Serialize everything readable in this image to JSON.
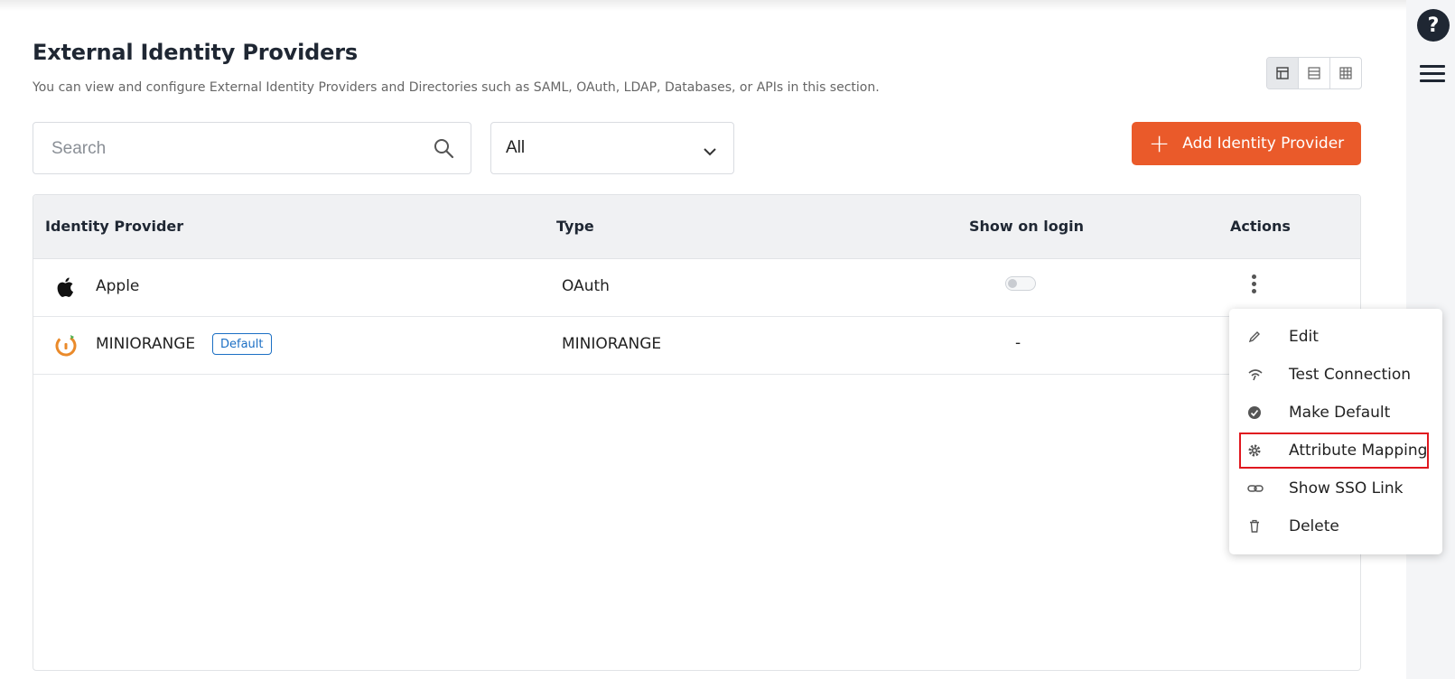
{
  "page": {
    "title": "External Identity Providers",
    "subtitle": "You can view and configure External Identity Providers and Directories such as SAML, OAuth, LDAP, Databases, or APIs in this section."
  },
  "toolbar": {
    "search_placeholder": "Search",
    "filter_value": "All",
    "add_button_label": "Add Identity Provider",
    "accent_color": "#ea5a2a"
  },
  "table": {
    "columns": [
      "Identity Provider",
      "Type",
      "Show on login",
      "Actions"
    ],
    "rows": [
      {
        "name": "Apple",
        "type": "OAuth",
        "show_on_login": "off",
        "icon": "apple-icon"
      },
      {
        "name": "MINIORANGE",
        "badge": "Default",
        "type": "MINIORANGE",
        "show_on_login": "-",
        "icon": "miniorange-icon"
      }
    ]
  },
  "actions_menu": {
    "items": [
      {
        "label": "Edit",
        "icon": "pencil-icon"
      },
      {
        "label": "Test Connection",
        "icon": "signal-icon"
      },
      {
        "label": "Make Default",
        "icon": "check-circle-icon"
      },
      {
        "label": "Attribute Mapping",
        "icon": "gear-icon",
        "highlighted": true
      },
      {
        "label": "Show SSO Link",
        "icon": "link-icon"
      },
      {
        "label": "Delete",
        "icon": "trash-icon"
      }
    ]
  },
  "rail": {
    "help_label": "?"
  }
}
